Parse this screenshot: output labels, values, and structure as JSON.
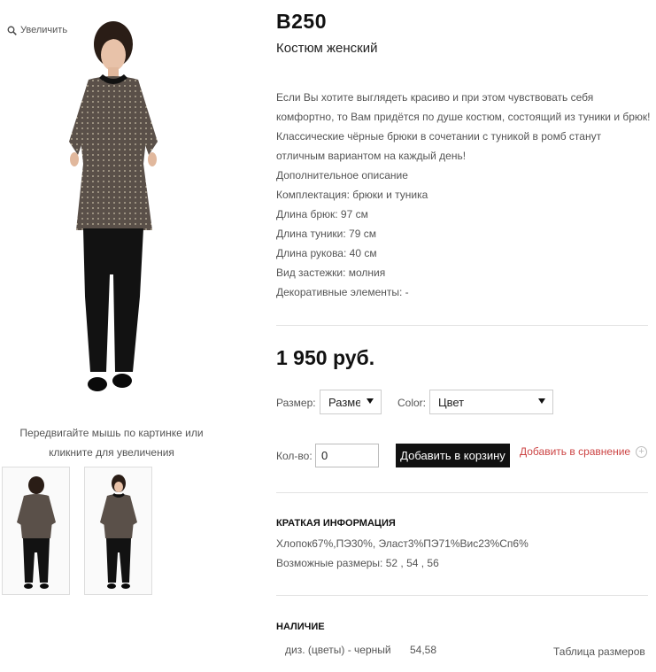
{
  "gallery": {
    "zoom_label": "Увеличить",
    "hint": "Передвигайте мышь по картинке или кликните для увеличения"
  },
  "product": {
    "sku": "B250",
    "name": "Костюм женский",
    "description_lines": [
      "Если Вы хотите выглядеть красиво и при этом чувствовать себя",
      "комфортно, то Вам придётся по душе костюм, состоящий из туники и брюк!",
      "Классические чёрные брюки в сочетании с туникой в ромб станут",
      "отличным вариантом на каждый день!",
      "Дополнительное описание",
      "Комплектация: брюки и туника",
      "Длина брюк: 97 см",
      "Длина туники: 79 см",
      "Длина рукова: 40 см",
      "Вид застежки: молния",
      "Декоративные элементы: -"
    ],
    "price": "1 950 руб."
  },
  "options": {
    "size_label": "Размер:",
    "size_value": "Размер",
    "color_label": "Color:",
    "color_value": "Цвет",
    "qty_label": "Кол-во:",
    "qty_value": "0",
    "add_to_cart": "Добавить в корзину",
    "add_to_compare": "Добавить в сравнение"
  },
  "short_info": {
    "title": "КРАТКАЯ ИНФОРМАЦИЯ",
    "composition": "Хлопок67%,ПЭ30%, Эласт3%ПЭ71%Вис23%Сп6%",
    "sizes": "Возможные размеры: 52 , 54 , 56"
  },
  "availability": {
    "title": "НАЛИЧИЕ",
    "variant": "диз. (цветы) - черный",
    "sizes": "54,58",
    "size_chart_link": "Таблица размеров"
  },
  "colors": {
    "accent_red": "#cc4444",
    "button_black": "#111111",
    "tunic": "#5a5049",
    "trousers": "#121212"
  }
}
